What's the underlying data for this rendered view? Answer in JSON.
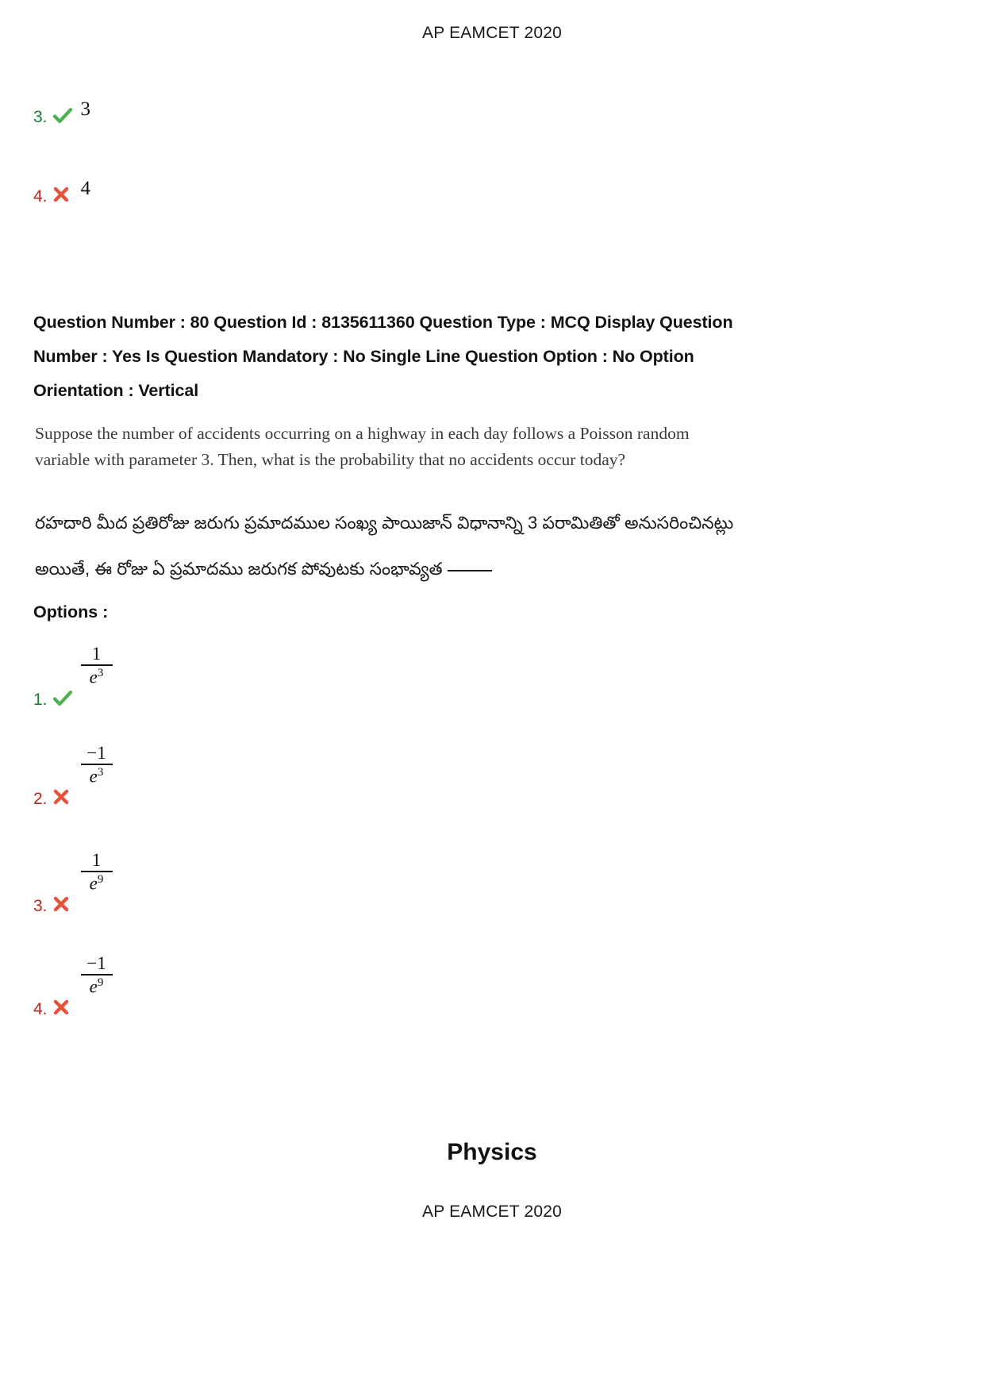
{
  "header": {
    "exam_title": "AP EAMCET 2020"
  },
  "footer": {
    "exam_title": "AP EAMCET 2020"
  },
  "previous_question_options": [
    {
      "number": "3.",
      "mark": "check-icon",
      "status": "correct",
      "value": "3"
    },
    {
      "number": "4.",
      "mark": "cross-icon",
      "status": "wrong",
      "value": "4"
    }
  ],
  "question": {
    "meta_line_1": "Question Number : 80 Question Id : 8135611360 Question Type : MCQ Display Question",
    "meta_line_2": "Number : Yes Is Question Mandatory : No Single Line Question Option : No Option",
    "meta_line_3": "Orientation : Vertical",
    "question_number": "80",
    "question_id": "8135611360",
    "question_type": "MCQ",
    "display_question_number": "Yes",
    "is_question_mandatory": "No",
    "single_line_question_option": "No",
    "option_orientation": "Vertical",
    "body_en_line_1": "Suppose the number of accidents occurring on a highway in each day follows a Poisson random",
    "body_en_line_2": "variable with parameter 3. Then, what is the probability that no accidents occur today?",
    "body_te_line_1": "రహదారి మీద ప్రతిరోజు జరుగు ప్రమాదముల సంఖ్య పాయిజాన్ విధానాన్ని 3 పరామితితో అనుసరించినట్లు",
    "body_te_line_2": "అయితే, ఈ రోజు ఏ ప్రమాదము జరుగక పోవుటకు సంభావ్యత",
    "options_label": "Options :",
    "options": [
      {
        "number": "1.",
        "mark": "check-icon",
        "status": "correct",
        "numerator": "1",
        "denominator": "e",
        "exponent": "3"
      },
      {
        "number": "2.",
        "mark": "cross-icon",
        "status": "wrong",
        "numerator": "−1",
        "denominator": "e",
        "exponent": "3"
      },
      {
        "number": "3.",
        "mark": "cross-icon",
        "status": "wrong",
        "numerator": "1",
        "denominator": "e",
        "exponent": "9"
      },
      {
        "number": "4.",
        "mark": "cross-icon",
        "status": "wrong",
        "numerator": "−1",
        "denominator": "e",
        "exponent": "9"
      }
    ]
  },
  "section": {
    "title": "Physics"
  },
  "colors": {
    "correct_green": "#4caf50",
    "wrong_red": "#e8503a",
    "correct_text": "#1d7a33",
    "wrong_text": "#c0261c"
  }
}
